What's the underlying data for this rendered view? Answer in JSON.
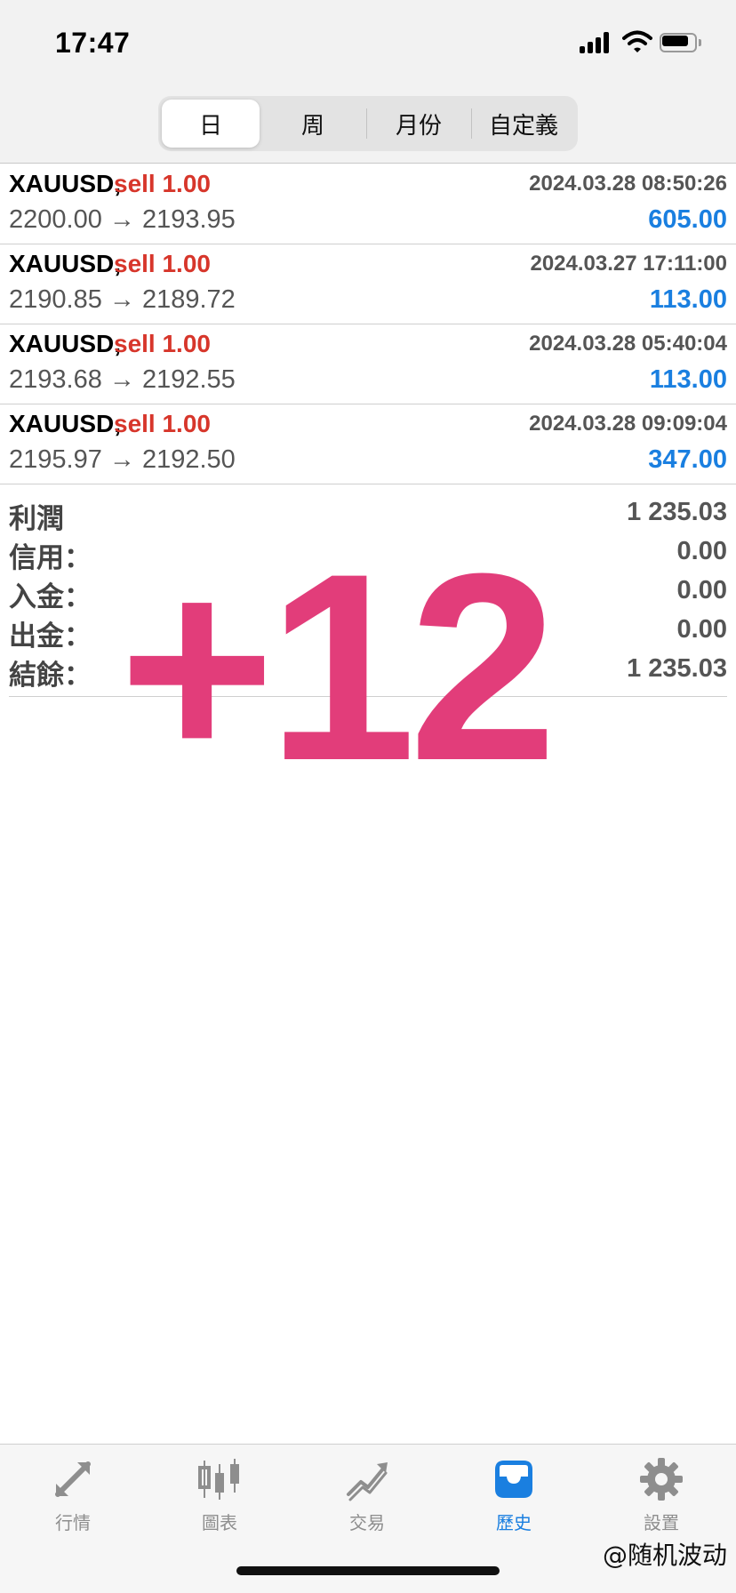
{
  "status_bar": {
    "time": "17:47",
    "battery_level": 0.8
  },
  "period_tabs": [
    {
      "label": "日",
      "active": true
    },
    {
      "label": "周",
      "active": false
    },
    {
      "label": "月份",
      "active": false
    },
    {
      "label": "自定義",
      "active": false
    }
  ],
  "trades": [
    {
      "symbol": "XAUUSD,",
      "side": "sell 1.00",
      "time": "2024.03.28 08:50:26",
      "prices": "2200.00 → 2193.95",
      "profit": "605.00"
    },
    {
      "symbol": "XAUUSD,",
      "side": "sell 1.00",
      "time": "2024.03.27 17:11:00",
      "prices": "2190.85 → 2189.72",
      "profit": "113.00"
    },
    {
      "symbol": "XAUUSD,",
      "side": "sell 1.00",
      "time": "2024.03.28 05:40:04",
      "prices": "2193.68 → 2192.55",
      "profit": "113.00"
    },
    {
      "symbol": "XAUUSD,",
      "side": "sell 1.00",
      "time": "2024.03.28 09:09:04",
      "prices": "2195.97 → 2192.50",
      "profit": "347.00"
    }
  ],
  "summary": [
    {
      "label": "利潤",
      "value": "1 235.03"
    },
    {
      "label": "信用：",
      "value": "0.00"
    },
    {
      "label": "入金：",
      "value": "0.00"
    },
    {
      "label": "出金：",
      "value": "0.00"
    },
    {
      "label": "結餘：",
      "value": "1 235.03"
    }
  ],
  "overlay": {
    "text": "+12",
    "color": "#e23d7a"
  },
  "tab_bar": [
    {
      "label": "行情",
      "icon": "quotes-arrows-icon",
      "active": false
    },
    {
      "label": "圖表",
      "icon": "candlestick-chart-icon",
      "active": false
    },
    {
      "label": "交易",
      "icon": "trade-trend-icon",
      "active": false
    },
    {
      "label": "歷史",
      "icon": "history-inbox-icon",
      "active": true
    },
    {
      "label": "設置",
      "icon": "gear-icon",
      "active": false
    }
  ],
  "watermark": "@随机波动",
  "colors": {
    "sell": "#d7362b",
    "profit": "#1a7fe0",
    "active_tab": "#1a7fe0",
    "inactive_tab": "#8e8e8e"
  }
}
